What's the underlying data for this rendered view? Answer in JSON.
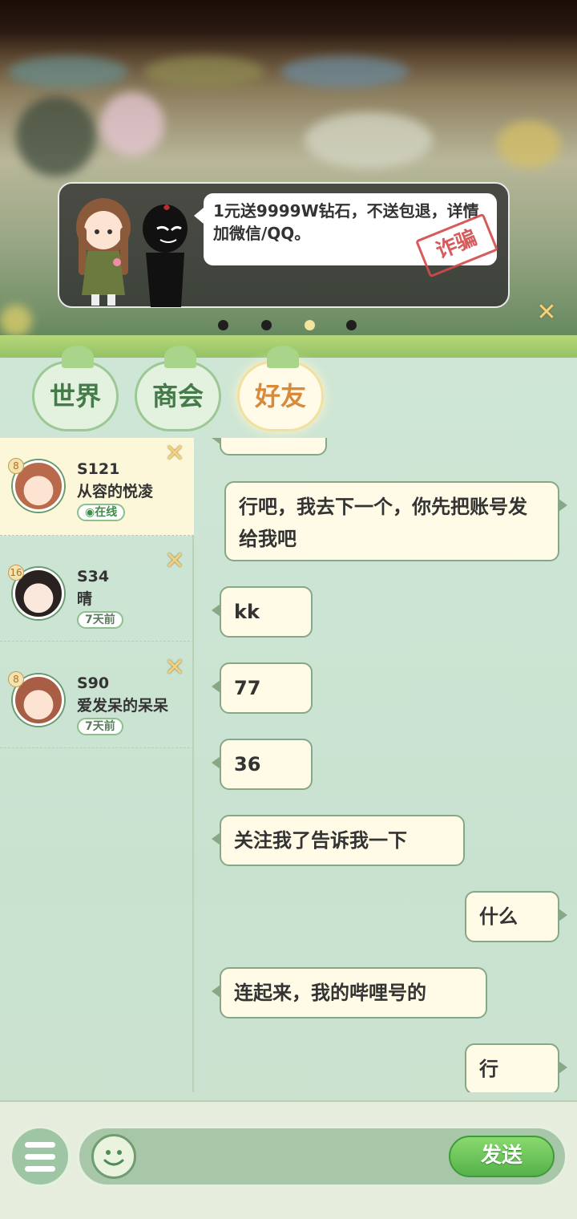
{
  "banner": {
    "warning_text": "1元送9999W钻石，不送包退，详情加微信/QQ。",
    "stamp": "诈骗",
    "dots": [
      false,
      false,
      true,
      false
    ]
  },
  "tabs": [
    {
      "label": "世界",
      "active": false
    },
    {
      "label": "商会",
      "active": false
    },
    {
      "label": "好友",
      "active": true
    }
  ],
  "friends": [
    {
      "level": "8",
      "server": "S121",
      "name": "从容的悦凌",
      "status": "◉在线",
      "online": true,
      "selected": true
    },
    {
      "level": "16",
      "server": "S34",
      "name": "晴",
      "status": "7天前",
      "online": false,
      "selected": false
    },
    {
      "level": "8",
      "server": "S90",
      "name": "爱发呆的呆呆",
      "status": "7天前",
      "online": false,
      "selected": false
    }
  ],
  "messages": [
    {
      "side": "right",
      "text": "行吧，我去下一个，你先把账号发给我吧"
    },
    {
      "side": "left",
      "text": "kk"
    },
    {
      "side": "left",
      "text": "77"
    },
    {
      "side": "left",
      "text": "36"
    },
    {
      "side": "left",
      "text": "关注我了告诉我一下"
    },
    {
      "side": "right",
      "text": "什么"
    },
    {
      "side": "left",
      "text": "连起来，我的哔哩号的"
    },
    {
      "side": "right",
      "text": "行"
    }
  ],
  "input": {
    "send_label": "发送"
  },
  "colors": {
    "accent": "#55b24a",
    "active_tab_text": "#d78a3a",
    "tab_text": "#477a4a"
  }
}
